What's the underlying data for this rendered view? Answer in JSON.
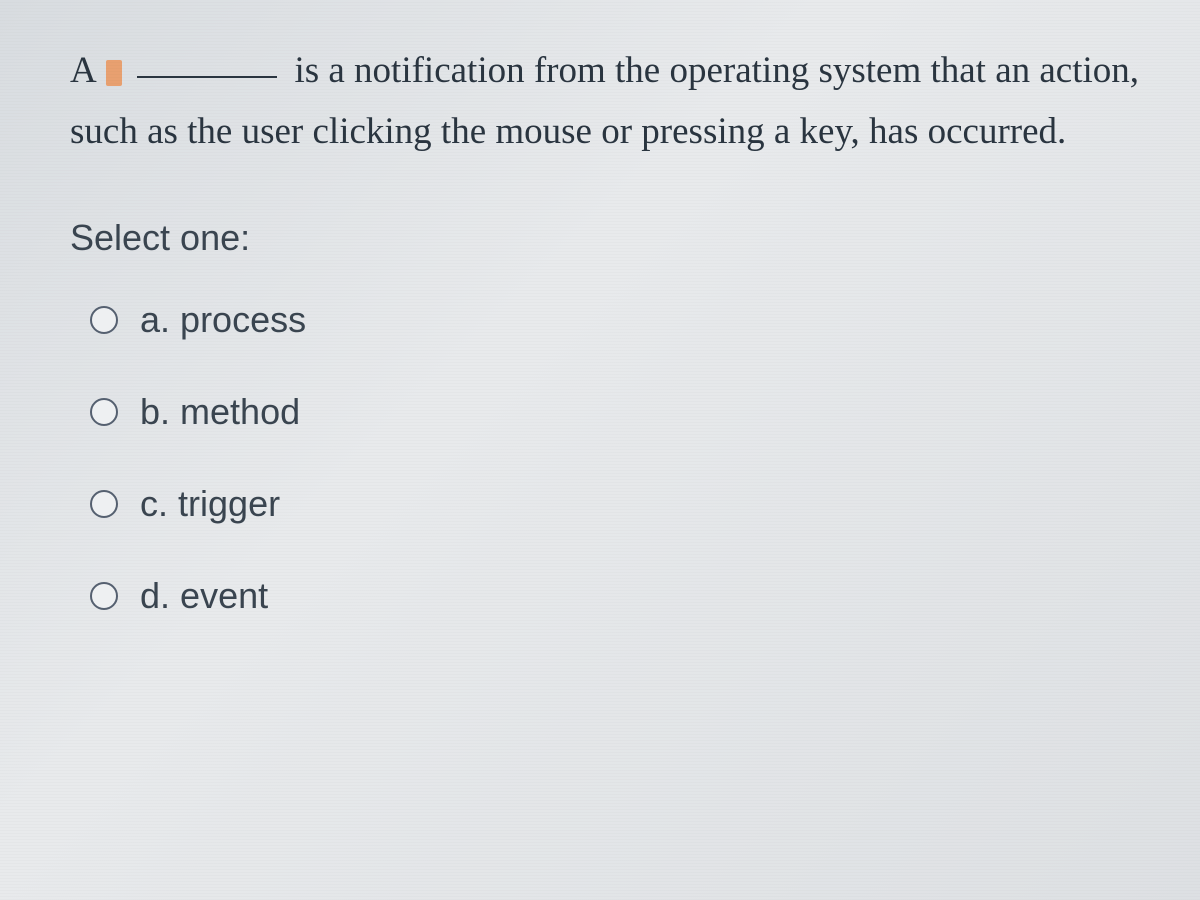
{
  "question": {
    "prefix": "A",
    "suffix": " is a notification from the operating system that an action, such as the user clicking the mouse or pressing a key, has occurred."
  },
  "prompt": "Select one:",
  "options": [
    {
      "letter": "a.",
      "text": "process"
    },
    {
      "letter": "b.",
      "text": "method"
    },
    {
      "letter": "c.",
      "text": "trigger"
    },
    {
      "letter": "d.",
      "text": "event"
    }
  ]
}
